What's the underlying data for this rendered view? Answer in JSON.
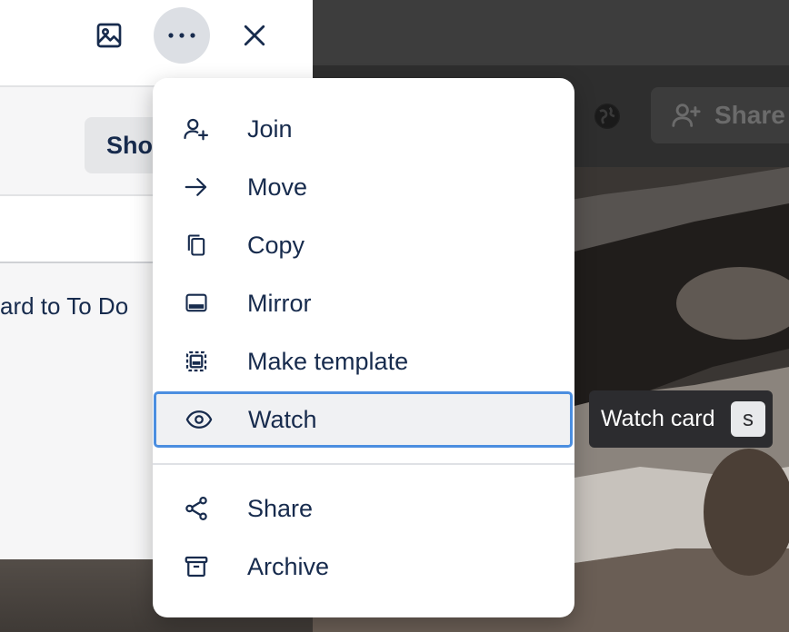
{
  "card_header": {
    "icons": [
      "image-icon",
      "more-icon",
      "close-icon"
    ]
  },
  "card": {
    "show_button_label": "Sho",
    "activity_text": "ard to To Do"
  },
  "board_bar": {
    "share_label": "Share"
  },
  "menu": {
    "items": [
      {
        "label": "Join",
        "icon": "add-person-icon"
      },
      {
        "label": "Move",
        "icon": "arrow-right-icon"
      },
      {
        "label": "Copy",
        "icon": "copy-icon"
      },
      {
        "label": "Mirror",
        "icon": "mirror-icon"
      },
      {
        "label": "Make template",
        "icon": "template-icon"
      },
      {
        "label": "Watch",
        "icon": "eye-icon"
      },
      {
        "label": "Share",
        "icon": "share-icon"
      },
      {
        "label": "Archive",
        "icon": "archive-icon"
      }
    ]
  },
  "tooltip": {
    "text": "Watch card",
    "shortcut": "s"
  },
  "colors": {
    "text": "#172b4d",
    "focus_ring": "#4b8ee0",
    "tooltip_bg": "#2c2c2f"
  }
}
